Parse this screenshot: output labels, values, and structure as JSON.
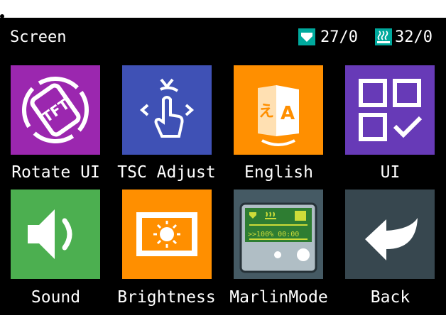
{
  "header": {
    "title": "Screen",
    "nozzle_temp": "27/0",
    "bed_temp": "32/0"
  },
  "menu": {
    "items": [
      {
        "label": "Rotate UI",
        "icon": "rotate-tft-icon",
        "color": "#9b27af"
      },
      {
        "label": "TSC Adjust",
        "icon": "touch-adjust-icon",
        "color": "#3f51b5"
      },
      {
        "label": "English",
        "icon": "language-icon",
        "color": "#ff8f00"
      },
      {
        "label": "UI",
        "icon": "ui-grid-icon",
        "color": "#673ab7"
      },
      {
        "label": "Sound",
        "icon": "speaker-icon",
        "color": "#4caf50"
      },
      {
        "label": "Brightness",
        "icon": "brightness-icon",
        "color": "#ff8f00"
      },
      {
        "label": "MarlinMode",
        "icon": "marlin-mode-icon",
        "color": "#455a64"
      },
      {
        "label": "Back",
        "icon": "back-arrow-icon",
        "color": "#37474f"
      }
    ]
  },
  "colors": {
    "background": "#000000",
    "status_icon": "#00a99d"
  }
}
